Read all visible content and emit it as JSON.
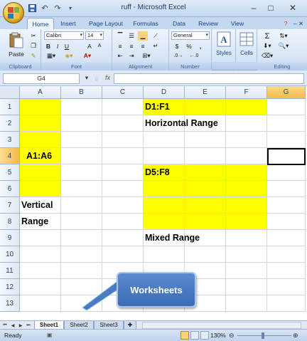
{
  "window": {
    "title": "ruff - Microsoft Excel"
  },
  "qat": {
    "undo": "↶",
    "redo": "↷"
  },
  "tabs": [
    "Home",
    "Insert",
    "Page Layout",
    "Formulas",
    "Data",
    "Review",
    "View"
  ],
  "ribbon": {
    "clipboard": {
      "label": "Clipboard",
      "paste": "Paste"
    },
    "font": {
      "label": "Font",
      "name": "Calibri",
      "size": "14",
      "bold": "B",
      "italic": "I",
      "underline": "U",
      "grow": "A",
      "shrink": "A"
    },
    "alignment": {
      "label": "Alignment"
    },
    "number": {
      "label": "Number",
      "format": "General",
      "currency": "$",
      "percent": "%",
      "comma": ","
    },
    "styles": {
      "label": "Styles"
    },
    "cells": {
      "label": "Cells"
    },
    "editing": {
      "label": "Editing",
      "sum": "Σ"
    }
  },
  "formula_bar": {
    "name_box": "G4",
    "fx": "fx",
    "value": ""
  },
  "columns": [
    "A",
    "B",
    "C",
    "D",
    "E",
    "F",
    "G"
  ],
  "rows": [
    "1",
    "2",
    "3",
    "4",
    "5",
    "6",
    "7",
    "8",
    "9",
    "10",
    "11",
    "12",
    "13"
  ],
  "cells": {
    "D1": "D1:F1",
    "D2": "Horizontal Range",
    "A4": "A1:A6",
    "D5": "D5:F8",
    "A7": "Vertical",
    "A8": "Range",
    "D9": "Mixed Range"
  },
  "callout": {
    "text": "Worksheets"
  },
  "sheets": [
    "Sheet1",
    "Sheet2",
    "Sheet3"
  ],
  "status": {
    "ready": "Ready",
    "zoom": "130%"
  },
  "colors": {
    "highlight": "#ffff00",
    "callout": "#4a7cc4"
  }
}
